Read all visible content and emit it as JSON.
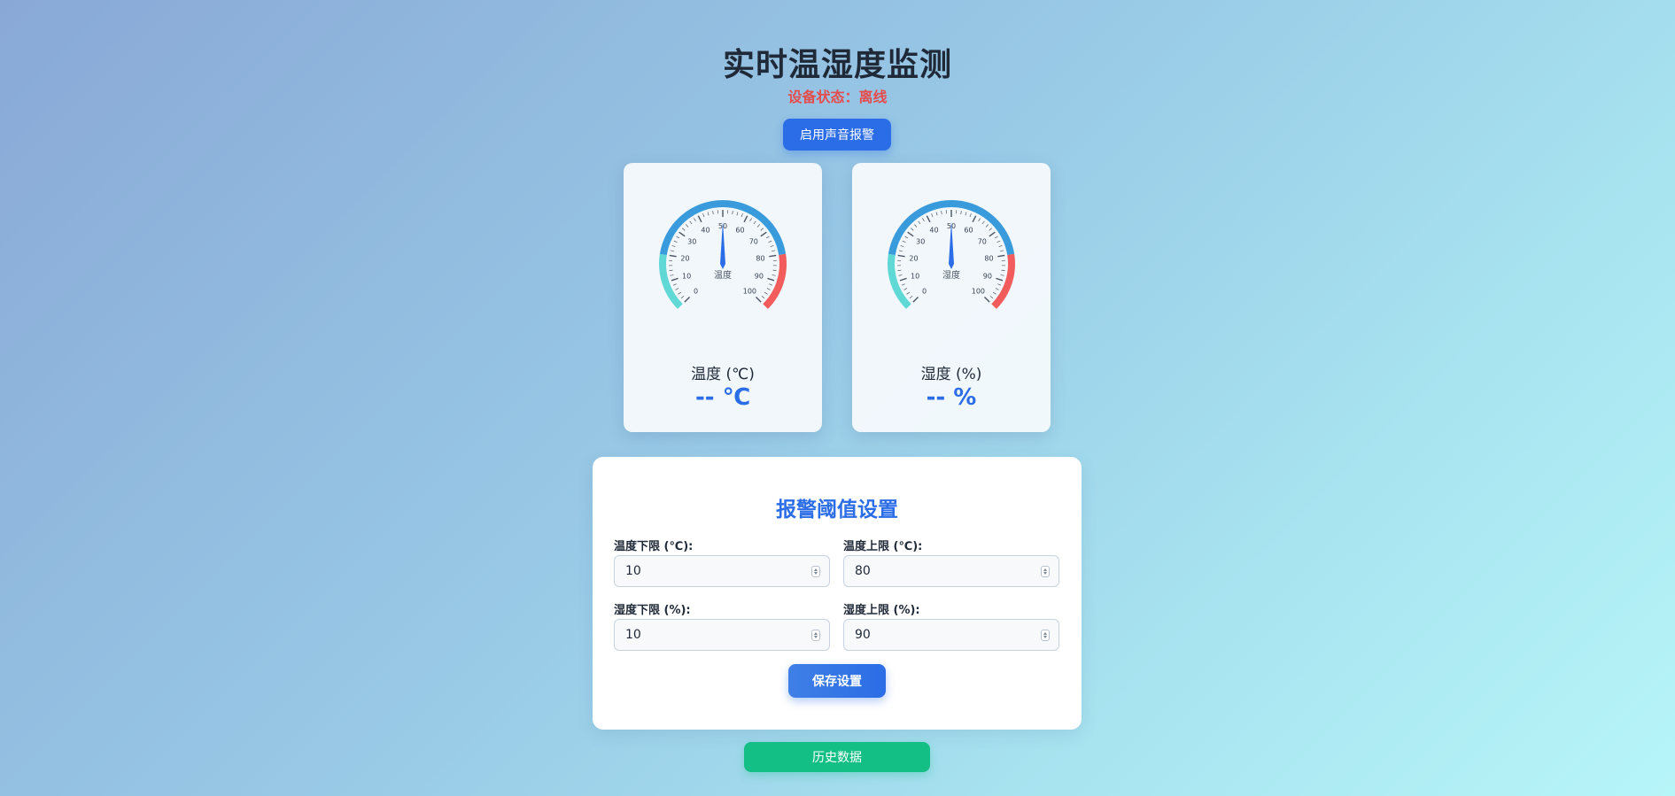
{
  "header": {
    "title": "实时温湿度监测",
    "status_prefix": "设备状态：",
    "status_value": "离线",
    "sound_alarm_label": "启用声音报警"
  },
  "colors": {
    "accent": "#2b6de6",
    "status_offline": "#e74c4c",
    "gauge_low": "#5fd8d6",
    "gauge_mid": "#3a9bdc",
    "gauge_high": "#f25c5c",
    "history_button": "#13bf84"
  },
  "gauges": [
    {
      "id": "temperature",
      "dial_name": "温度",
      "ticks": [
        "0",
        "10",
        "20",
        "30",
        "40",
        "50",
        "60",
        "70",
        "80",
        "90",
        "100"
      ],
      "label": "温度 (℃)",
      "value_text": "-- ℃",
      "needle_value": 50
    },
    {
      "id": "humidity",
      "dial_name": "湿度",
      "ticks": [
        "0",
        "10",
        "20",
        "30",
        "40",
        "50",
        "60",
        "70",
        "80",
        "90",
        "100"
      ],
      "label": "湿度 (%)",
      "value_text": "-- %",
      "needle_value": 50
    }
  ],
  "settings": {
    "title": "报警阈值设置",
    "temp_low_label": "温度下限 (℃):",
    "temp_low_value": "10",
    "temp_high_label": "温度上限 (℃):",
    "temp_high_value": "80",
    "hum_low_label": "湿度下限 (%):",
    "hum_low_value": "10",
    "hum_high_label": "湿度上限 (%):",
    "hum_high_value": "90",
    "save_label": "保存设置"
  },
  "history_label": "历史数据"
}
